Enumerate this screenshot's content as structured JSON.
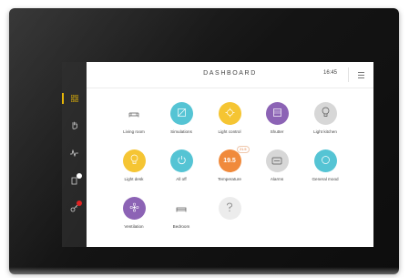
{
  "header": {
    "title": "DASHBOARD",
    "time": "16:45"
  },
  "sidebar": {
    "items": [
      {
        "icon": "grid-icon",
        "active": true
      },
      {
        "icon": "hand-icon",
        "active": false
      },
      {
        "icon": "pulse-icon",
        "active": false
      },
      {
        "icon": "document-icon",
        "active": false,
        "badge": "white"
      },
      {
        "icon": "key-icon",
        "active": false,
        "badge": "red"
      }
    ]
  },
  "tiles": [
    {
      "label": "Living room",
      "icon": "sofa-icon",
      "color": "#ffffff"
    },
    {
      "label": "Simulations",
      "icon": "simulation-icon",
      "color": "#55c4d4"
    },
    {
      "label": "Light control",
      "icon": "light-control-icon",
      "color": "#f5c533"
    },
    {
      "label": "Shutter",
      "icon": "shutter-icon",
      "color": "#8c63b5"
    },
    {
      "label": "Light kitchen",
      "icon": "bulb-icon",
      "color": "#d7d7d7"
    },
    {
      "label": "Light desk",
      "icon": "bulb-icon",
      "color": "#f5c533"
    },
    {
      "label": "All off",
      "icon": "power-icon",
      "color": "#55c4d4"
    },
    {
      "label": "Temperature",
      "icon": "thermometer-icon",
      "color": "#f08a3c",
      "value": "19.5",
      "badge": "21.5"
    },
    {
      "label": "Alarms",
      "icon": "alarm-icon",
      "color": "#d7d7d7"
    },
    {
      "label": "General mood",
      "icon": "mood-icon",
      "color": "#55c4d4"
    },
    {
      "label": "Ventilation",
      "icon": "fan-icon",
      "color": "#8c63b5"
    },
    {
      "label": "Bedroom",
      "icon": "bed-icon",
      "color": "#ffffff"
    },
    {
      "label": "",
      "icon": "question-icon",
      "color": "#ececec"
    }
  ]
}
